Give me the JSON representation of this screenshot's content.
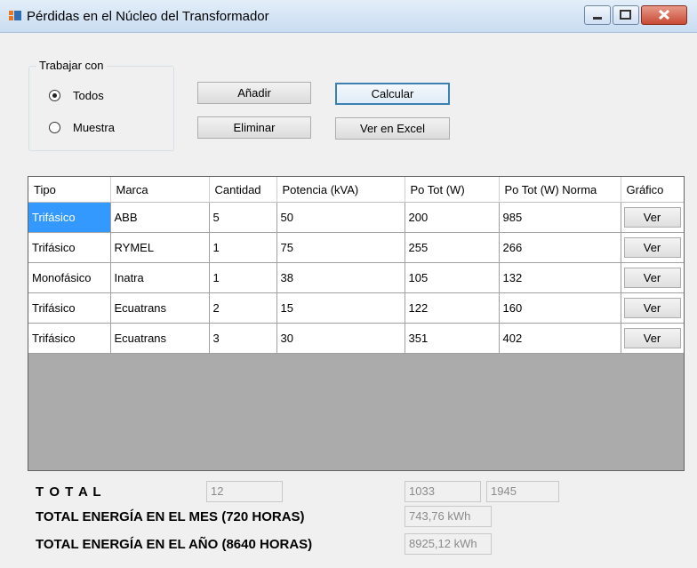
{
  "window": {
    "title": "Pérdidas en el Núcleo del Transformador",
    "controls": [
      "minimize-icon",
      "maximize-icon",
      "close-icon"
    ]
  },
  "group": {
    "label": "Trabajar con",
    "options": [
      {
        "label": "Todos",
        "checked": true
      },
      {
        "label": "Muestra",
        "checked": false
      }
    ]
  },
  "buttons": {
    "add": "Añadir",
    "delete": "Eliminar",
    "calculate": "Calcular",
    "excel": "Ver en Excel"
  },
  "table": {
    "columns": [
      "Tipo",
      "Marca",
      "Cantidad",
      "Potencia (kVA)",
      "Po Tot (W)",
      "Po Tot (W) Norma",
      "Gráfico"
    ],
    "rows": [
      [
        "Trifásico",
        "ABB",
        "5",
        "50",
        "200",
        "985",
        "Ver"
      ],
      [
        "Trifásico",
        "RYMEL",
        "1",
        "75",
        "255",
        "266",
        "Ver"
      ],
      [
        "Monofásico",
        "Inatra",
        "1",
        "38",
        "105",
        "132",
        "Ver"
      ],
      [
        "Trifásico",
        "Ecuatrans",
        "2",
        "15",
        "122",
        "160",
        "Ver"
      ],
      [
        "Trifásico",
        "Ecuatrans",
        "3",
        "30",
        "351",
        "402",
        "Ver"
      ]
    ]
  },
  "totals": {
    "label": "T O T A L",
    "cantidad": "12",
    "po_tot": "1033",
    "po_tot_norma": "1945",
    "month_label": "TOTAL ENERGÍA EN EL MES (720 HORAS)",
    "month_value": "743,76 kWh",
    "year_label": "TOTAL ENERGÍA EN EL AÑO (8640 HORAS)",
    "year_value": "8925,12 kWh"
  },
  "colors": {
    "selection": "#3399ff",
    "grid_background": "#ababab",
    "window_background": "#f0f0f0"
  }
}
